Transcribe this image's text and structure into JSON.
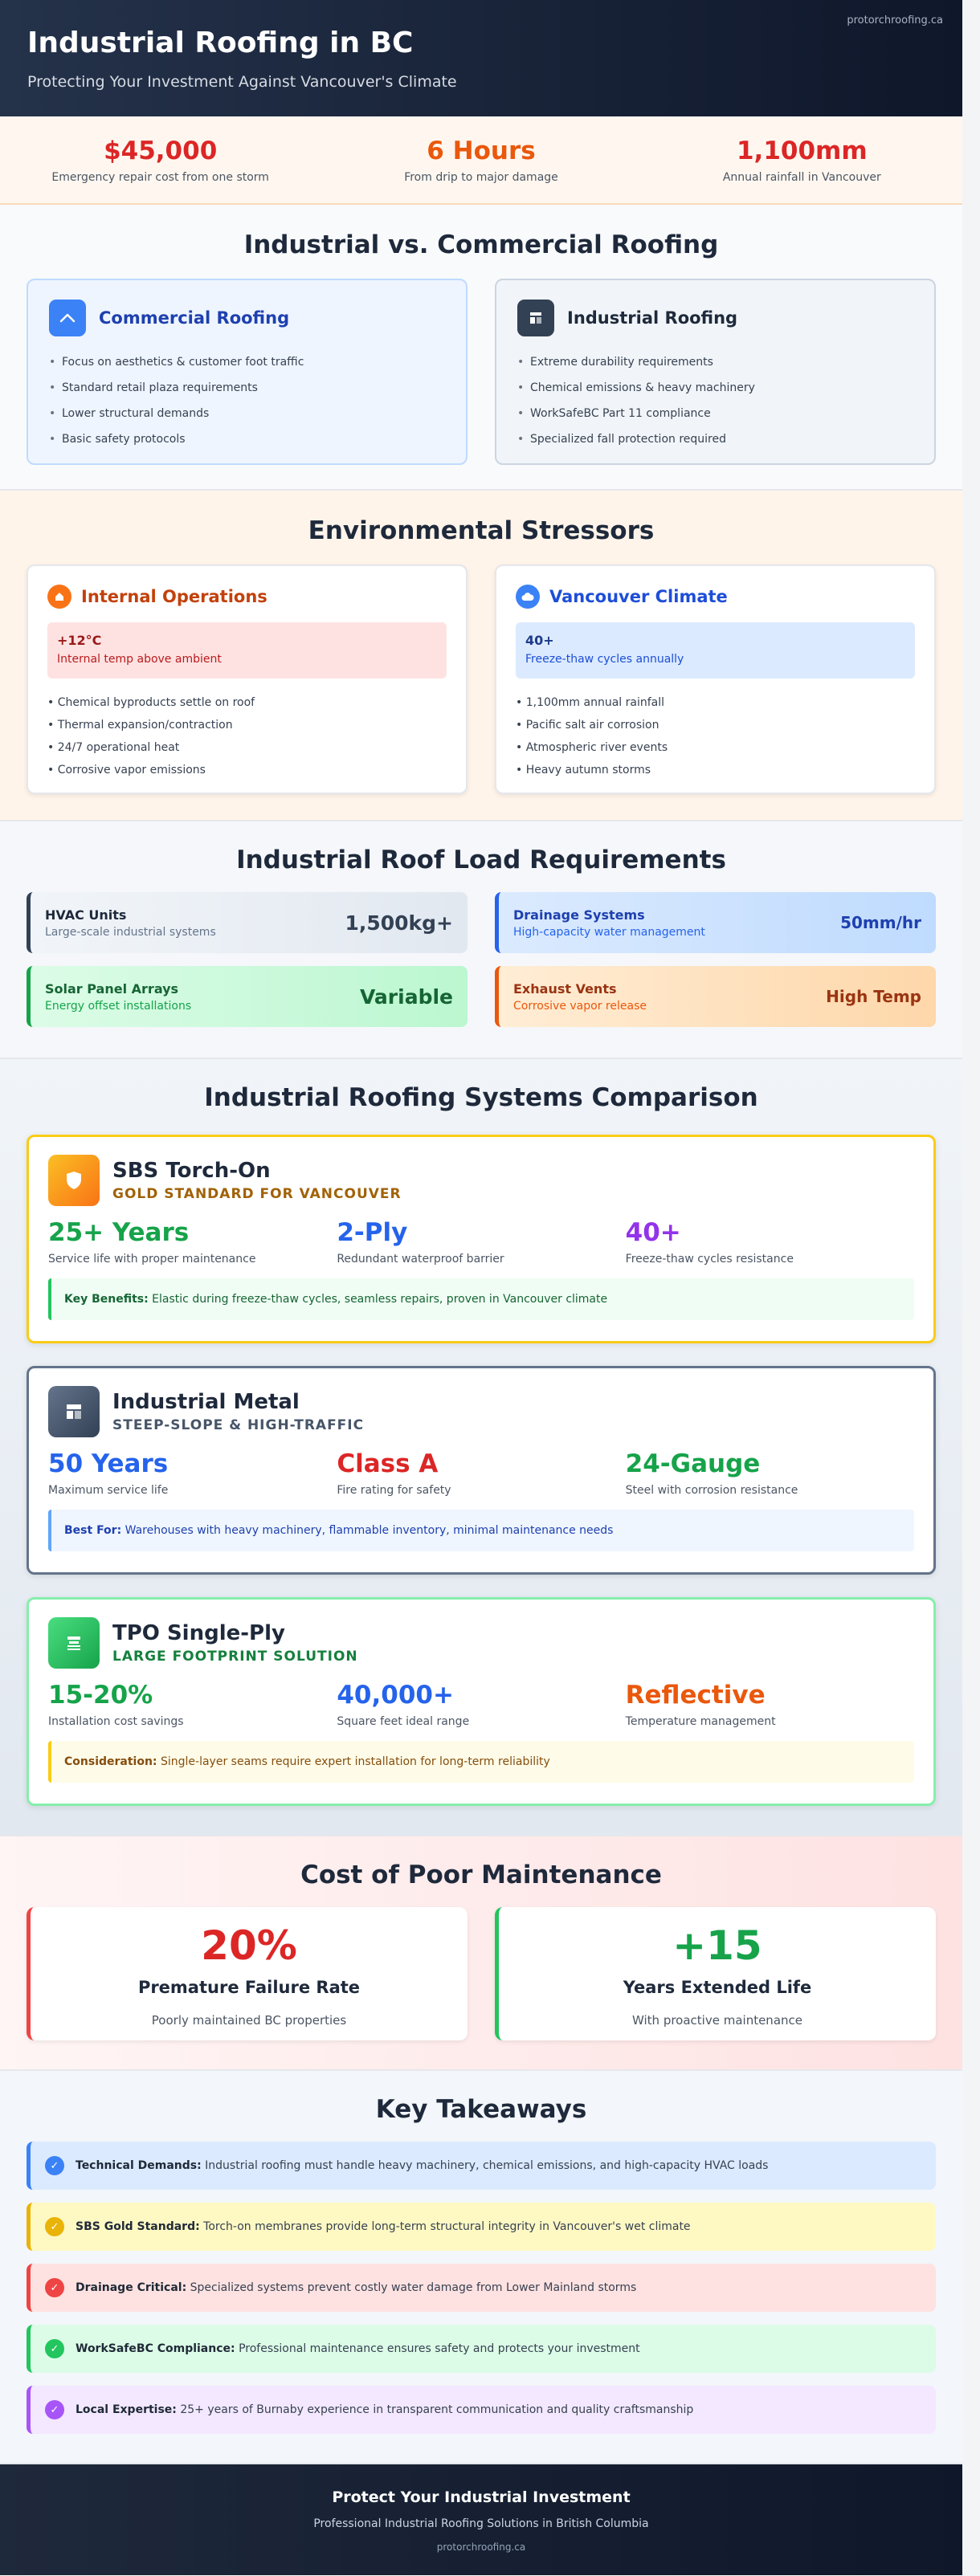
{
  "header": {
    "site": "protorchroofing.ca",
    "title": "Industrial Roofing in BC",
    "subtitle": "Protecting Your Investment Against Vancouver's Climate"
  },
  "stats": [
    {
      "value": "$45,000",
      "label": "Emergency repair cost from one storm",
      "color": "#dc2626"
    },
    {
      "value": "6 Hours",
      "label": "From drip to major damage",
      "color": "#ea580c"
    },
    {
      "value": "1,100mm",
      "label": "Annual rainfall in Vancouver",
      "color": "#dc2626"
    }
  ],
  "compare": {
    "title": "Industrial vs. Commercial Roofing",
    "commercial": {
      "title": "Commercial Roofing",
      "icon": "roof-icon",
      "items": [
        "Focus on aesthetics & customer foot traffic",
        "Standard retail plaza requirements",
        "Lower structural demands",
        "Basic safety protocols"
      ]
    },
    "industrial": {
      "title": "Industrial Roofing",
      "icon": "building-icon",
      "items": [
        "Extreme durability requirements",
        "Chemical emissions & heavy machinery",
        "WorkSafeBC Part 11 compliance",
        "Specialized fall protection required"
      ]
    }
  },
  "env": {
    "title": "Environmental Stressors",
    "internal": {
      "title": "Internal Operations",
      "icon": "home-icon",
      "box_value": "+12°C",
      "box_label": "Internal temp above ambient",
      "items": [
        "• Chemical byproducts settle on roof",
        "• Thermal expansion/contraction",
        "• 24/7 operational heat",
        "• Corrosive vapor emissions"
      ]
    },
    "climate": {
      "title": "Vancouver Climate",
      "icon": "cloud-icon",
      "box_value": "40+",
      "box_label": "Freeze-thaw cycles annually",
      "items": [
        "• 1,100mm annual rainfall",
        "• Pacific salt air corrosion",
        "• Atmospheric river events",
        "• Heavy autumn storms"
      ]
    }
  },
  "loads": {
    "title": "Industrial Roof Load Requirements",
    "items": [
      {
        "name": "HVAC Units",
        "desc": "Large-scale industrial systems",
        "value": "1,500kg+"
      },
      {
        "name": "Drainage Systems",
        "desc": "High-capacity water management",
        "value": "50mm/hr"
      },
      {
        "name": "Solar Panel Arrays",
        "desc": "Energy offset installations",
        "value": "Variable"
      },
      {
        "name": "Exhaust Vents",
        "desc": "Corrosive vapor release",
        "value": "High Temp"
      }
    ]
  },
  "systems": {
    "title": "Industrial Roofing Systems Comparison",
    "items": [
      {
        "title": "SBS Torch-On",
        "subtitle": "Gold Standard for Vancouver",
        "icon": "shield-icon",
        "metrics": [
          {
            "value": "25+ Years",
            "label": "Service life with proper maintenance"
          },
          {
            "value": "2-Ply",
            "label": "Redundant waterproof barrier"
          },
          {
            "value": "40+",
            "label": "Freeze-thaw cycles resistance"
          }
        ],
        "note_label": "Key Benefits:",
        "note_text": " Elastic during freeze-thaw cycles, seamless repairs, proven in Vancouver climate"
      },
      {
        "title": "Industrial Metal",
        "subtitle": "Steep-Slope & High-Traffic",
        "icon": "layout-icon",
        "metrics": [
          {
            "value": "50 Years",
            "label": "Maximum service life"
          },
          {
            "value": "Class A",
            "label": "Fire rating for safety"
          },
          {
            "value": "24-Gauge",
            "label": "Steel with corrosion resistance"
          }
        ],
        "note_label": "Best For:",
        "note_text": " Warehouses with heavy machinery, flammable inventory, minimal maintenance needs"
      },
      {
        "title": "TPO Single-Ply",
        "subtitle": "Large Footprint Solution",
        "icon": "layers-icon",
        "metrics": [
          {
            "value": "15-20%",
            "label": "Installation cost savings"
          },
          {
            "value": "40,000+",
            "label": "Square feet ideal range"
          },
          {
            "value": "Reflective",
            "label": "Temperature management"
          }
        ],
        "note_label": "Consideration:",
        "note_text": " Single-layer seams require expert installation for long-term reliability"
      }
    ]
  },
  "maint": {
    "title": "Cost of Poor Maintenance",
    "items": [
      {
        "value": "20%",
        "title": "Premature Failure Rate",
        "sub": "Poorly maintained BC properties"
      },
      {
        "value": "+15",
        "title": "Years Extended Life",
        "sub": "With proactive maintenance"
      }
    ]
  },
  "takeaways": {
    "title": "Key Takeaways",
    "items": [
      {
        "label": "Technical Demands:",
        "text": " Industrial roofing must handle heavy machinery, chemical emissions, and high-capacity HVAC loads"
      },
      {
        "label": "SBS Gold Standard:",
        "text": " Torch-on membranes provide long-term structural integrity in Vancouver's wet climate"
      },
      {
        "label": "Drainage Critical:",
        "text": " Specialized systems prevent costly water damage from Lower Mainland storms"
      },
      {
        "label": "WorkSafeBC Compliance:",
        "text": " Professional maintenance ensures safety and protects your investment"
      },
      {
        "label": "Local Expertise:",
        "text": " 25+ years of Burnaby experience in transparent communication and quality craftsmanship"
      }
    ]
  },
  "footer": {
    "title": "Protect Your Industrial Investment",
    "subtitle": "Professional Industrial Roofing Solutions in British Columbia",
    "url": "protorchroofing.ca"
  }
}
